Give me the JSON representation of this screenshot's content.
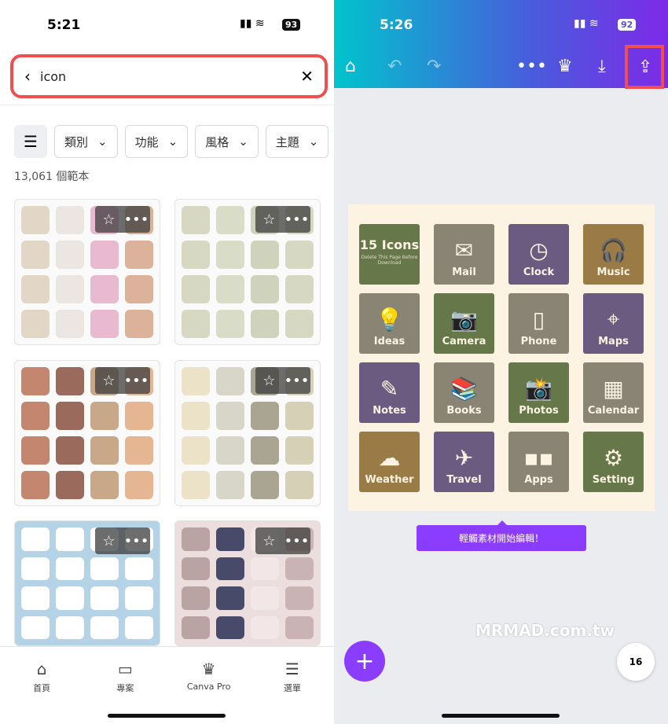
{
  "left": {
    "status": {
      "time": "5:21",
      "battery": "93"
    },
    "search": {
      "query": "icon"
    },
    "filters": [
      "類別",
      "功能",
      "風格",
      "主題"
    ],
    "result_count": "13,061 個範本",
    "templates": [
      {
        "colors": [
          "#e2d6c6",
          "#ece6e2",
          "#e9b9cf",
          "#dcb39a"
        ]
      },
      {
        "colors": [
          "#d6d8c2",
          "#d9dcc6",
          "#d0d3bb",
          "#d6d8c2"
        ]
      },
      {
        "colors": [
          "#c58670",
          "#9a6a5c",
          "#c8a888",
          "#e6b592"
        ]
      },
      {
        "colors": [
          "#ece2c8",
          "#d8d6c8",
          "#aaa592",
          "#d6d0b6"
        ]
      },
      {
        "colors": [
          "#ffffff",
          "#ffffff",
          "#ffffff",
          "#ffffff"
        ],
        "bg": "#b5d3e6"
      },
      {
        "colors": [
          "#b9a3a3",
          "#484a6a",
          "#f2e6e6",
          "#c9b3b3"
        ],
        "bg": "#ecdede"
      }
    ],
    "nav": [
      {
        "label": "首頁",
        "icon": "home-icon"
      },
      {
        "label": "專案",
        "icon": "folder-icon"
      },
      {
        "label": "Canva Pro",
        "icon": "crown-icon"
      },
      {
        "label": "選單",
        "icon": "menu-icon"
      }
    ]
  },
  "right": {
    "status": {
      "time": "5:26",
      "battery": "92"
    },
    "tiles": [
      {
        "label": "15 Icons",
        "sub": "Delete This Page Before Download",
        "color": "#66784a",
        "glyph": ""
      },
      {
        "label": "Mail",
        "color": "#8a8474",
        "glyph": "✉"
      },
      {
        "label": "Clock",
        "color": "#6b5b80",
        "glyph": "◷"
      },
      {
        "label": "Music",
        "color": "#9a7b45",
        "glyph": "🎧"
      },
      {
        "label": "Ideas",
        "color": "#8a8474",
        "glyph": "💡"
      },
      {
        "label": "Camera",
        "color": "#66784a",
        "glyph": "📷"
      },
      {
        "label": "Phone",
        "color": "#8a8474",
        "glyph": "▯"
      },
      {
        "label": "Maps",
        "color": "#6b5b80",
        "glyph": "⌖"
      },
      {
        "label": "Notes",
        "color": "#6b5b80",
        "glyph": "✎"
      },
      {
        "label": "Books",
        "color": "#8a8474",
        "glyph": "📚"
      },
      {
        "label": "Photos",
        "color": "#66784a",
        "glyph": "📸"
      },
      {
        "label": "Calendar",
        "color": "#8a8474",
        "glyph": "▦"
      },
      {
        "label": "Weather",
        "color": "#9a7b45",
        "glyph": "☁"
      },
      {
        "label": "Travel",
        "color": "#6b5b80",
        "glyph": "✈"
      },
      {
        "label": "Apps",
        "color": "#8a8474",
        "glyph": "▪▪"
      },
      {
        "label": "Setting",
        "color": "#66784a",
        "glyph": "⚙"
      }
    ],
    "tooltip": "輕觸素材開始編輯！",
    "page_count": "16",
    "watermark": "MRMAD.com.tw"
  }
}
